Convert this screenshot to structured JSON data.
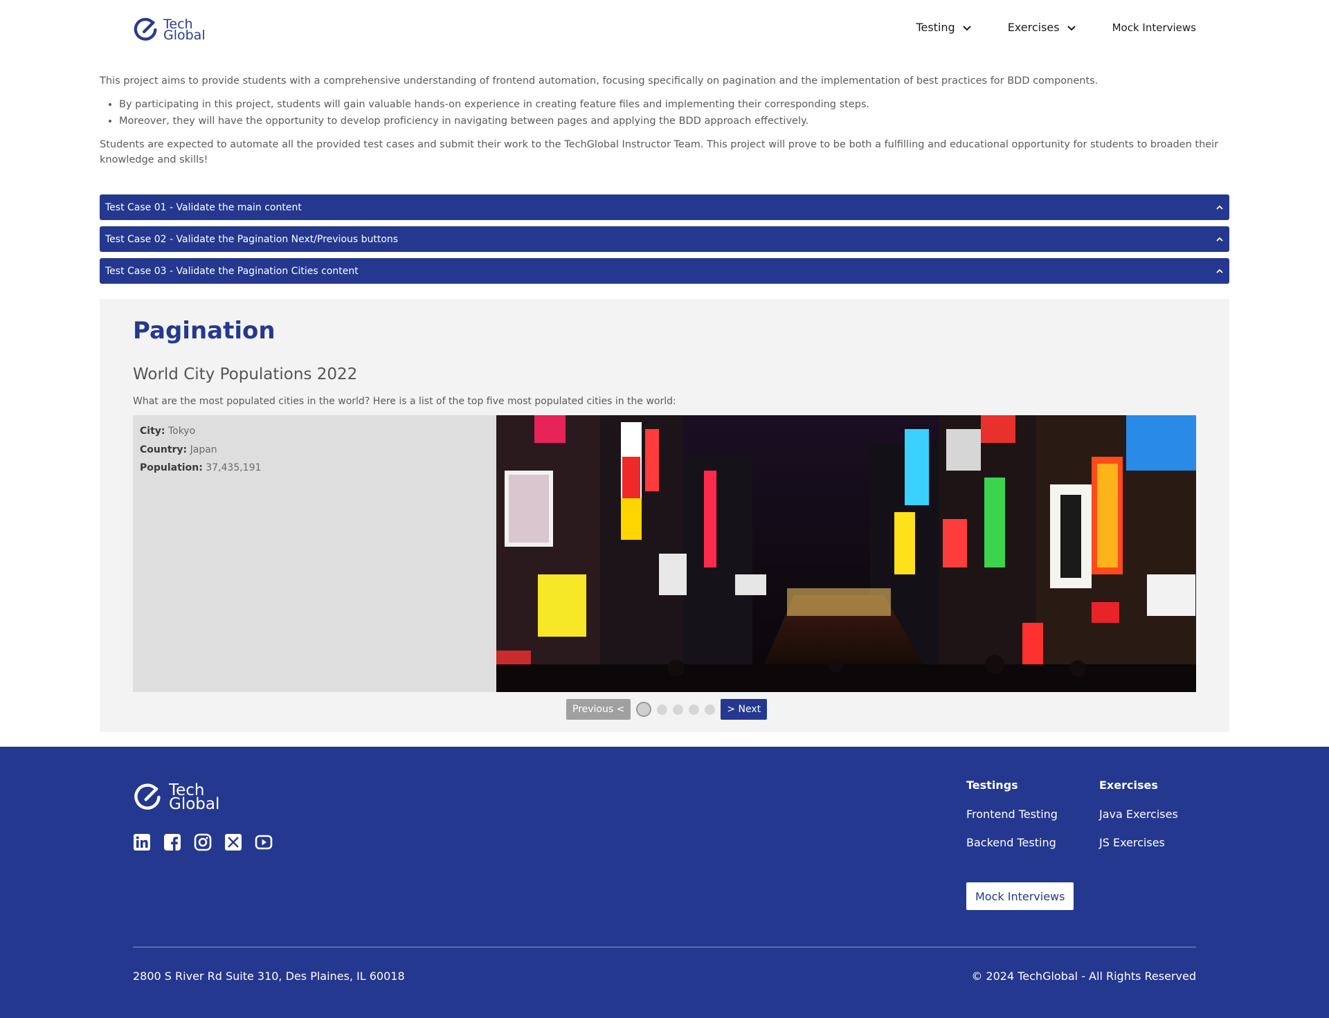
{
  "header": {
    "logo_line1": "Tech",
    "logo_line2": "Global",
    "nav": {
      "testing": "Testing",
      "exercises": "Exercises",
      "mock_interviews": "Mock Interviews"
    }
  },
  "intro": {
    "paragraph1": "This project aims to provide students with a comprehensive understanding of frontend automation, focusing specifically on pagination and the implementation of best practices for BDD components.",
    "bullets": [
      "By participating in this project, students will gain valuable hands-on experience in creating feature files and implementing their corresponding steps.",
      "Moreover, they will have the opportunity to develop proficiency in navigating between pages and applying the BDD approach effectively."
    ],
    "paragraph2": "Students are expected to automate all the provided test cases and submit their work to the TechGlobal Instructor Team. This project will prove to be both a fulfilling and educational opportunity for students to broaden their knowledge and skills!"
  },
  "accordions": [
    "Test Case 01 - Validate the main content",
    "Test Case 02 - Validate the Pagination Next/Previous buttons",
    "Test Case 03 - Validate the Pagination Cities content"
  ],
  "pagination": {
    "title": "Pagination",
    "subtitle": "World City Populations 2022",
    "description": "What are the most populated cities in the world? Here is a list of the top five most populated cities in the world:",
    "city_label": "City:",
    "city_value": "Tokyo",
    "country_label": "Country:",
    "country_value": "Japan",
    "population_label": "Population:",
    "population_value": "37,435,191",
    "prev_label": "Previous <",
    "next_label": "> Next",
    "current_page": 1,
    "total_pages": 5
  },
  "footer": {
    "logo_line1": "Tech",
    "logo_line2": "Global",
    "socials": [
      "linkedin-icon",
      "facebook-icon",
      "instagram-icon",
      "x-icon",
      "youtube-icon"
    ],
    "testings_title": "Testings",
    "testings_links": [
      "Frontend Testing",
      "Backend Testing"
    ],
    "exercises_title": "Exercises",
    "exercises_links": [
      "Java Exercises",
      "JS Exercises"
    ],
    "mock_button": "Mock Interviews",
    "address": "2800 S River Rd Suite 310, Des Plaines, IL 60018",
    "copyright": "© 2024 TechGlobal - All Rights Reserved"
  },
  "colors": {
    "brand": "#24388f",
    "panel_bg": "#f3f3f3",
    "info_bg": "#dedede"
  }
}
